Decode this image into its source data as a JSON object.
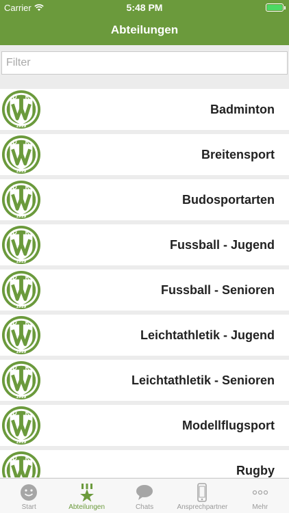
{
  "status_bar": {
    "carrier": "Carrier",
    "time": "5:48 PM"
  },
  "nav": {
    "title": "Abteilungen"
  },
  "filter": {
    "placeholder": "Filter",
    "value": ""
  },
  "colors": {
    "brand": "#6b9a3c",
    "battery": "#4cd964"
  },
  "logo": {
    "letters_top": "DJK",
    "year": "1919"
  },
  "departments": [
    "Badminton",
    "Breitensport",
    "Budosportarten",
    "Fussball - Jugend",
    "Fussball - Senioren",
    "Leichtathletik - Jugend",
    "Leichtathletik - Senioren",
    "Modellflugsport",
    "Rugby"
  ],
  "tabs": [
    {
      "label": "Start",
      "icon": "smiley-icon",
      "active": false
    },
    {
      "label": "Abteilungen",
      "icon": "star-icon",
      "active": true
    },
    {
      "label": "Chats",
      "icon": "chat-bubble-icon",
      "active": false
    },
    {
      "label": "Ansprechpartner",
      "icon": "phone-icon",
      "active": false
    },
    {
      "label": "Mehr",
      "icon": "more-icon",
      "active": false
    }
  ]
}
